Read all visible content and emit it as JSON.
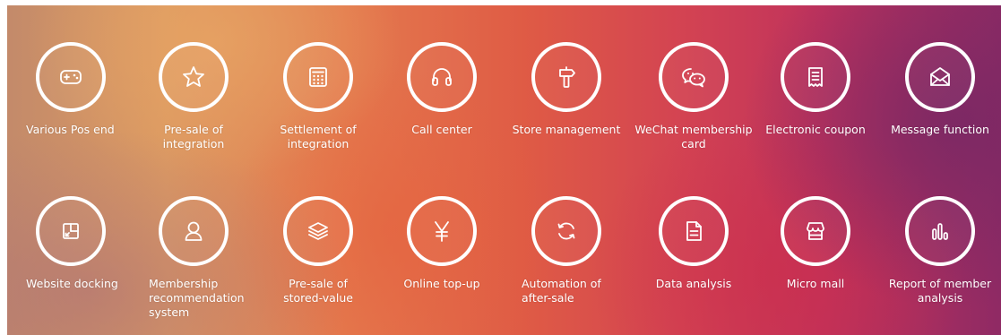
{
  "features": [
    {
      "label": "Various Pos end",
      "icon": "gamepad-icon"
    },
    {
      "label": "Pre-sale of\nintegration",
      "icon": "star-icon"
    },
    {
      "label": "Settlement of\nintegration",
      "icon": "calculator-icon"
    },
    {
      "label": "Call center",
      "icon": "headset-icon"
    },
    {
      "label": "Store management",
      "icon": "signpost-icon"
    },
    {
      "label": "WeChat membership\ncard",
      "icon": "wechat-icon"
    },
    {
      "label": "Electronic coupon",
      "icon": "receipt-icon"
    },
    {
      "label": "Message function",
      "icon": "envelope-icon"
    },
    {
      "label": "Website docking",
      "icon": "dock-icon"
    },
    {
      "label": "Membership\nrecommendation\nsystem",
      "icon": "user-icon"
    },
    {
      "label": "Pre-sale of\nstored-value",
      "icon": "layers-icon"
    },
    {
      "label": "Online top-up",
      "icon": "yen-icon"
    },
    {
      "label": "Automation of\nafter-sale",
      "icon": "refresh-icon"
    },
    {
      "label": "Data analysis",
      "icon": "document-icon"
    },
    {
      "label": "Micro mall",
      "icon": "shop-icon"
    },
    {
      "label": "Report of member\nanalysis",
      "icon": "bar-chart-icon"
    }
  ]
}
